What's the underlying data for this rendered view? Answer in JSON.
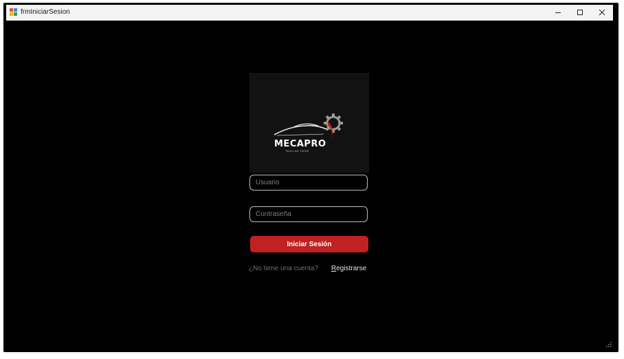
{
  "window": {
    "title": "frmIniciarSesion"
  },
  "logo": {
    "brand_name": "MECAPRO",
    "tagline": "TAGLINE HERE"
  },
  "form": {
    "username_placeholder": "Usuario",
    "password_placeholder": "Contraseña",
    "login_label": "Iniciar Sesión",
    "no_account_text": "¿No tiene una cuenta?",
    "register_first_letter": "R",
    "register_rest": "egistrarse"
  },
  "colors": {
    "background": "#000000",
    "accent": "#c02123",
    "logo_panel": "#121212"
  }
}
